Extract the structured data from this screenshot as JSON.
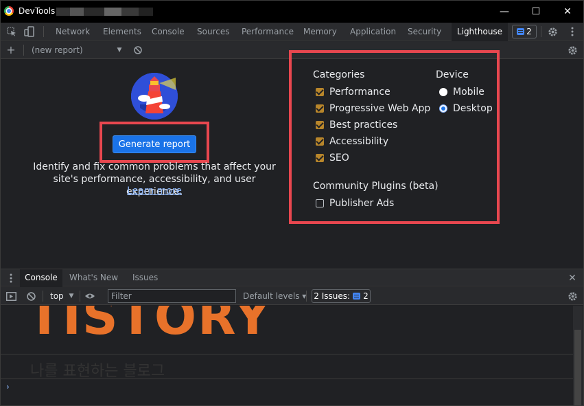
{
  "window": {
    "title": "DevTools",
    "controls": {
      "minimize": "—",
      "maximize": "☐",
      "close": "✕"
    }
  },
  "main_tabs": [
    {
      "label": "Network"
    },
    {
      "label": "Elements"
    },
    {
      "label": "Console"
    },
    {
      "label": "Sources"
    },
    {
      "label": "Performance"
    },
    {
      "label": "Memory"
    },
    {
      "label": "Application"
    },
    {
      "label": "Security"
    },
    {
      "label": "Lighthouse",
      "active": true
    }
  ],
  "issues_count": "2",
  "lighthouse_toolbar": {
    "report_select": "(new report)"
  },
  "lighthouse": {
    "generate_button": "Generate report",
    "intro_line1": "Identify and fix common problems that affect your",
    "intro_line2": "site's performance, accessibility, and user experience.",
    "learn_more": "Learn more",
    "categories_title": "Categories",
    "categories": [
      {
        "label": "Performance",
        "checked": true
      },
      {
        "label": "Progressive Web App",
        "checked": true
      },
      {
        "label": "Best practices",
        "checked": true
      },
      {
        "label": "Accessibility",
        "checked": true
      },
      {
        "label": "SEO",
        "checked": true
      }
    ],
    "device_title": "Device",
    "devices": [
      {
        "label": "Mobile",
        "selected": false
      },
      {
        "label": "Desktop",
        "selected": true
      }
    ],
    "plugins_title": "Community Plugins (beta)",
    "plugins": [
      {
        "label": "Publisher Ads",
        "checked": false
      }
    ]
  },
  "drawer": {
    "tabs": [
      {
        "label": "Console",
        "active": true
      },
      {
        "label": "What's New"
      },
      {
        "label": "Issues"
      }
    ]
  },
  "console_toolbar": {
    "context": "top",
    "filter_placeholder": "Filter",
    "levels": "Default levels ▾",
    "issues_label": "2 Issues:",
    "issues_count": "2"
  },
  "console_body": {
    "banner_text": "TISTORY",
    "banner_subtext": "나를 표현하는 블로그",
    "prompt": "›"
  },
  "colors": {
    "accent": "#1a73e8",
    "highlight_box": "#e8474f",
    "checkbox": "#b8862b",
    "banner": "#e8722a"
  }
}
